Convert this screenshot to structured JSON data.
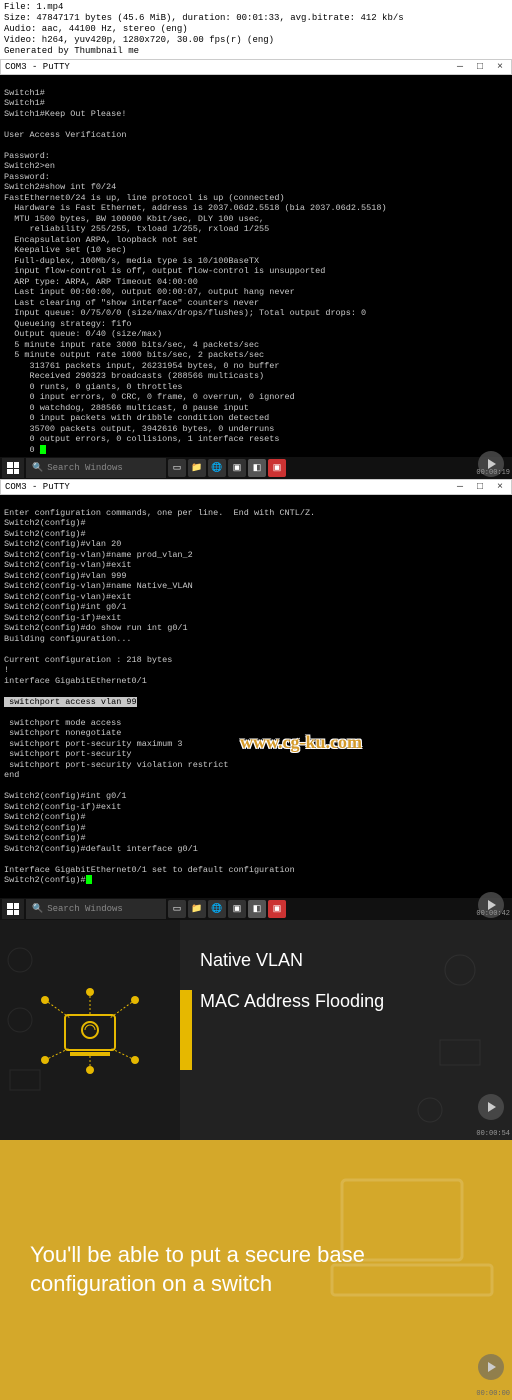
{
  "fileinfo": {
    "filename": "File: 1.mp4",
    "size": "Size: 47847171 bytes (45.6 MiB), duration: 00:01:33, avg.bitrate: 412 kb/s",
    "audio": "Audio: aac, 44100 Hz, stereo (eng)",
    "video": "Video: h264, yuv420p, 1280x720, 30.00 fps(r) (eng)",
    "generated": "Generated by Thumbnail me"
  },
  "putty1": {
    "title": "COM3 - PuTTY",
    "lines": [
      "Switch1#",
      "Switch1#",
      "Switch1#Keep Out Please!",
      "",
      "User Access Verification",
      "",
      "Password:",
      "Switch2>en",
      "Password:",
      "Switch2#show int f0/24",
      "FastEthernet0/24 is up, line protocol is up (connected)",
      "  Hardware is Fast Ethernet, address is 2037.06d2.5518 (bia 2037.06d2.5518)",
      "  MTU 1500 bytes, BW 100000 Kbit/sec, DLY 100 usec,",
      "     reliability 255/255, txload 1/255, rxload 1/255",
      "  Encapsulation ARPA, loopback not set",
      "  Keepalive set (10 sec)",
      "  Full-duplex, 100Mb/s, media type is 10/100BaseTX",
      "  input flow-control is off, output flow-control is unsupported",
      "  ARP type: ARPA, ARP Timeout 04:00:00",
      "  Last input 00:00:00, output 00:00:07, output hang never",
      "  Last clearing of \"show interface\" counters never",
      "  Input queue: 0/75/0/0 (size/max/drops/flushes); Total output drops: 0",
      "  Queueing strategy: fifo",
      "  Output queue: 0/40 (size/max)",
      "  5 minute input rate 3000 bits/sec, 4 packets/sec",
      "  5 minute output rate 1000 bits/sec, 2 packets/sec",
      "     313761 packets input, 26231954 bytes, 0 no buffer",
      "     Received 290323 broadcasts (288566 multicasts)",
      "     0 runts, 0 giants, 0 throttles",
      "     0 input errors, 0 CRC, 0 frame, 0 overrun, 0 ignored",
      "     0 watchdog, 288566 multicast, 0 pause input",
      "     0 input packets with dribble condition detected",
      "     35700 packets output, 3942616 bytes, 0 underruns",
      "     0 output errors, 0 collisions, 1 interface resets"
    ]
  },
  "putty2": {
    "title": "COM3 - PuTTY",
    "lines_top": [
      "Enter configuration commands, one per line.  End with CNTL/Z.",
      "Switch2(config)#",
      "Switch2(config)#",
      "Switch2(config)#vlan 20",
      "Switch2(config-vlan)#name prod_vlan_2",
      "Switch2(config-vlan)#exit",
      "Switch2(config)#vlan 999",
      "Switch2(config-vlan)#name Native_VLAN",
      "Switch2(config-vlan)#exit",
      "Switch2(config)#int g0/1",
      "Switch2(config-if)#exit",
      "Switch2(config)#do show run int g0/1",
      "Building configuration...",
      "",
      "Current configuration : 218 bytes",
      "!",
      "interface GigabitEthernet0/1"
    ],
    "line_highlight": " switchport access vlan 99",
    "lines_mid": [
      " switchport mode access",
      " switchport nonegotiate",
      " switchport port-security maximum 3",
      " switchport port-security",
      " switchport port-security violation restrict",
      "end",
      "",
      "Switch2(config)#int g0/1",
      "Switch2(config-if)#exit",
      "Switch2(config)#",
      "Switch2(config)#",
      "Switch2(config)#",
      "Switch2(config)#default interface g0/1"
    ],
    "line_partial": "Interface GigabitEthernet0/1 set to default configuration",
    "line_last": "Switch2(config)#"
  },
  "watermark": "www.cg-ku.com",
  "taskbar": {
    "search_placeholder": "Search Windows",
    "time1": "00:00:19",
    "time2": "00:00:42"
  },
  "slide1": {
    "heading1": "Native VLAN",
    "heading2": "MAC Address Flooding",
    "time": "00:00:54"
  },
  "slide2": {
    "text": "You'll be able to put a secure base configuration on a switch",
    "time": "00:00:00"
  },
  "icons": {
    "folder": "📁",
    "chrome": "🌐",
    "putty1": "▫",
    "putty2": "▫",
    "app": "▣"
  }
}
